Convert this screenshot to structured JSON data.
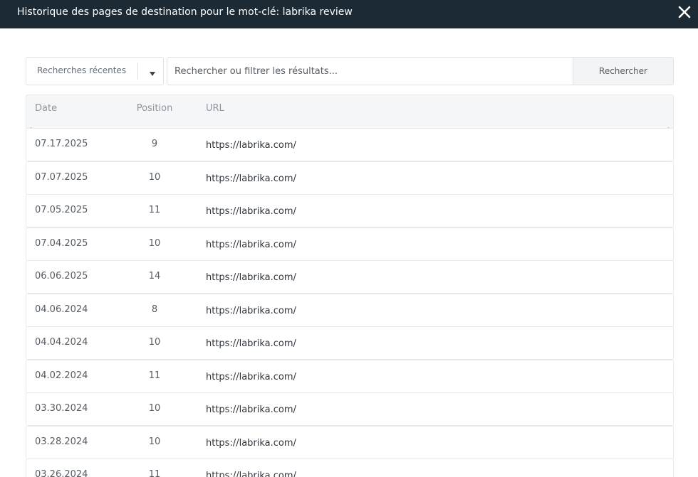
{
  "dialog": {
    "title": "Historique des pages de destination pour le mot-clé: labrika review"
  },
  "toolbar": {
    "recent_label": "Recherches récentes",
    "search_placeholder": "Rechercher ou filtrer les résultats...",
    "search_value": "",
    "search_button": "Rechercher"
  },
  "table": {
    "headers": {
      "date": "Date",
      "position": "Position",
      "url": "URL"
    },
    "rows": [
      {
        "date": "07.17.2025",
        "position": "9",
        "url": "https://labrika.com/"
      },
      {
        "date": "07.07.2025",
        "position": "10",
        "url": "https://labrika.com/"
      },
      {
        "date": "07.05.2025",
        "position": "11",
        "url": "https://labrika.com/"
      },
      {
        "date": "07.04.2025",
        "position": "10",
        "url": "https://labrika.com/"
      },
      {
        "date": "06.06.2025",
        "position": "14",
        "url": "https://labrika.com/"
      },
      {
        "date": "04.06.2024",
        "position": "8",
        "url": "https://labrika.com/"
      },
      {
        "date": "04.04.2024",
        "position": "10",
        "url": "https://labrika.com/"
      },
      {
        "date": "04.02.2024",
        "position": "11",
        "url": "https://labrika.com/"
      },
      {
        "date": "03.30.2024",
        "position": "10",
        "url": "https://labrika.com/"
      },
      {
        "date": "03.28.2024",
        "position": "10",
        "url": "https://labrika.com/"
      },
      {
        "date": "03.26.2024",
        "position": "11",
        "url": "https://labrika.com/"
      }
    ]
  },
  "colors": {
    "titlebar_bg": "#1b2a35",
    "header_bg": "#f4f6f8",
    "border": "#e6e9ec"
  }
}
